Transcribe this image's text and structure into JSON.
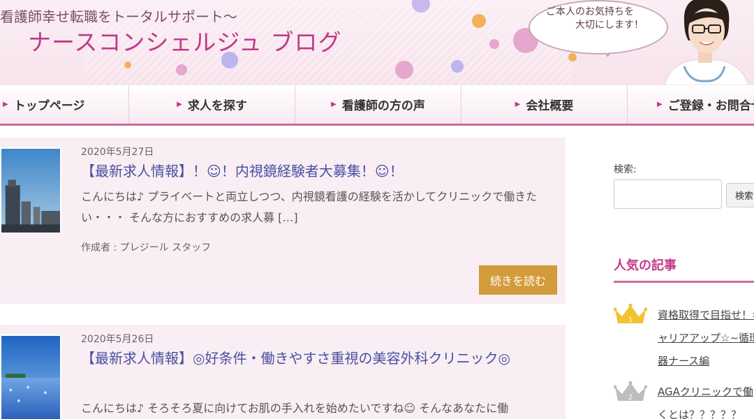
{
  "header": {
    "tagline": "看護師幸せ転職をトータルサポート～",
    "site_title": "ナースコンシェルジュ ブログ",
    "speech_line1": "ご本人のお気持ちを",
    "speech_line2": "大切にします！"
  },
  "nav": {
    "items": [
      {
        "label": "トップページ"
      },
      {
        "label": "求人を探す"
      },
      {
        "label": "看護師の方の声"
      },
      {
        "label": "会社概要"
      },
      {
        "label": "ご登録・お問合せ"
      }
    ]
  },
  "posts": [
    {
      "date": "2020年5月27日",
      "title": "【最新求人情報】！☺！内視鏡経験者大募集！☺！",
      "excerpt": "こんにちは♪ プライベートと両立しつつ、内視鏡看護の経験を活かしてクリニックで働きたい・・・ そんな方におすすめの求人募 […]",
      "author": "作成者 : プレジール スタッフ",
      "read_more": "続きを読む"
    },
    {
      "date": "2020年5月26日",
      "title": "【最新求人情報】◎好条件・働きやすさ重視の美容外科クリニック◎",
      "excerpt": "こんにちは♪ そろそろ夏に向けてお肌の手入れを始めたいですね☺ そんなあなたに働"
    }
  ],
  "sidebar": {
    "search_label": "検索:",
    "search_button": "検索",
    "popular_title": "人気の記事",
    "ranking": [
      {
        "rank": "1",
        "title": "資格取得で目指せ！キャリアアップ☆~循環器ナース編"
      },
      {
        "rank": "2",
        "title": "AGAクリニックで働くとは？？？？？"
      }
    ]
  },
  "colors": {
    "accent": "#c0398a",
    "nav_border": "#cd6a9e",
    "post_bg": "#f8eef4",
    "title_link": "#4a4fa0",
    "read_more_bg": "#d39b3a",
    "crown_gold": "#f2c230",
    "crown_silver": "#bdbdbd"
  }
}
